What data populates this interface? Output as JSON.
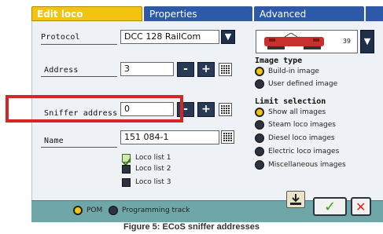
{
  "tabs": [
    {
      "label": "Edit loco"
    },
    {
      "label": "Properties"
    },
    {
      "label": "Advanced"
    }
  ],
  "protocol": {
    "label": "Protocol",
    "value": "DCC 128 RailCom"
  },
  "address": {
    "label": "Address",
    "value": "3"
  },
  "sniffer": {
    "label": "Sniffer address",
    "value": "0"
  },
  "name": {
    "label": "Name",
    "value": "151 084-1"
  },
  "loco_image": {
    "number": "39"
  },
  "image_type": {
    "title": "Image type",
    "options": [
      {
        "label": "Build-in image",
        "selected": true
      },
      {
        "label": "User defined image",
        "selected": false
      }
    ]
  },
  "limit_selection": {
    "title": "Limit selection",
    "options": [
      {
        "label": "Show all images",
        "selected": true
      },
      {
        "label": "Steam loco images",
        "selected": false
      },
      {
        "label": "Diesel loco images",
        "selected": false
      },
      {
        "label": "Electric loco images",
        "selected": false
      },
      {
        "label": "Miscellaneous images",
        "selected": false
      }
    ]
  },
  "loco_lists": [
    {
      "label": "Loco list 1",
      "checked": true
    },
    {
      "label": "Loco list 2",
      "checked": false
    },
    {
      "label": "Loco list 3",
      "checked": false
    }
  ],
  "bottom": {
    "pom_label": "POM",
    "programming_label": "Programming track",
    "pom_selected": true
  },
  "buttons": {
    "minus": "-",
    "plus": "+",
    "ok": "✓",
    "cancel": "✕",
    "down": "▼"
  },
  "caption": "Figure 5: ECoS sniffer addresses",
  "colors": {
    "tab_active": "#f2c411",
    "tab_inactive": "#2d5aa8",
    "highlight": "#d32626",
    "bottom_bar": "#6fa7a8"
  }
}
